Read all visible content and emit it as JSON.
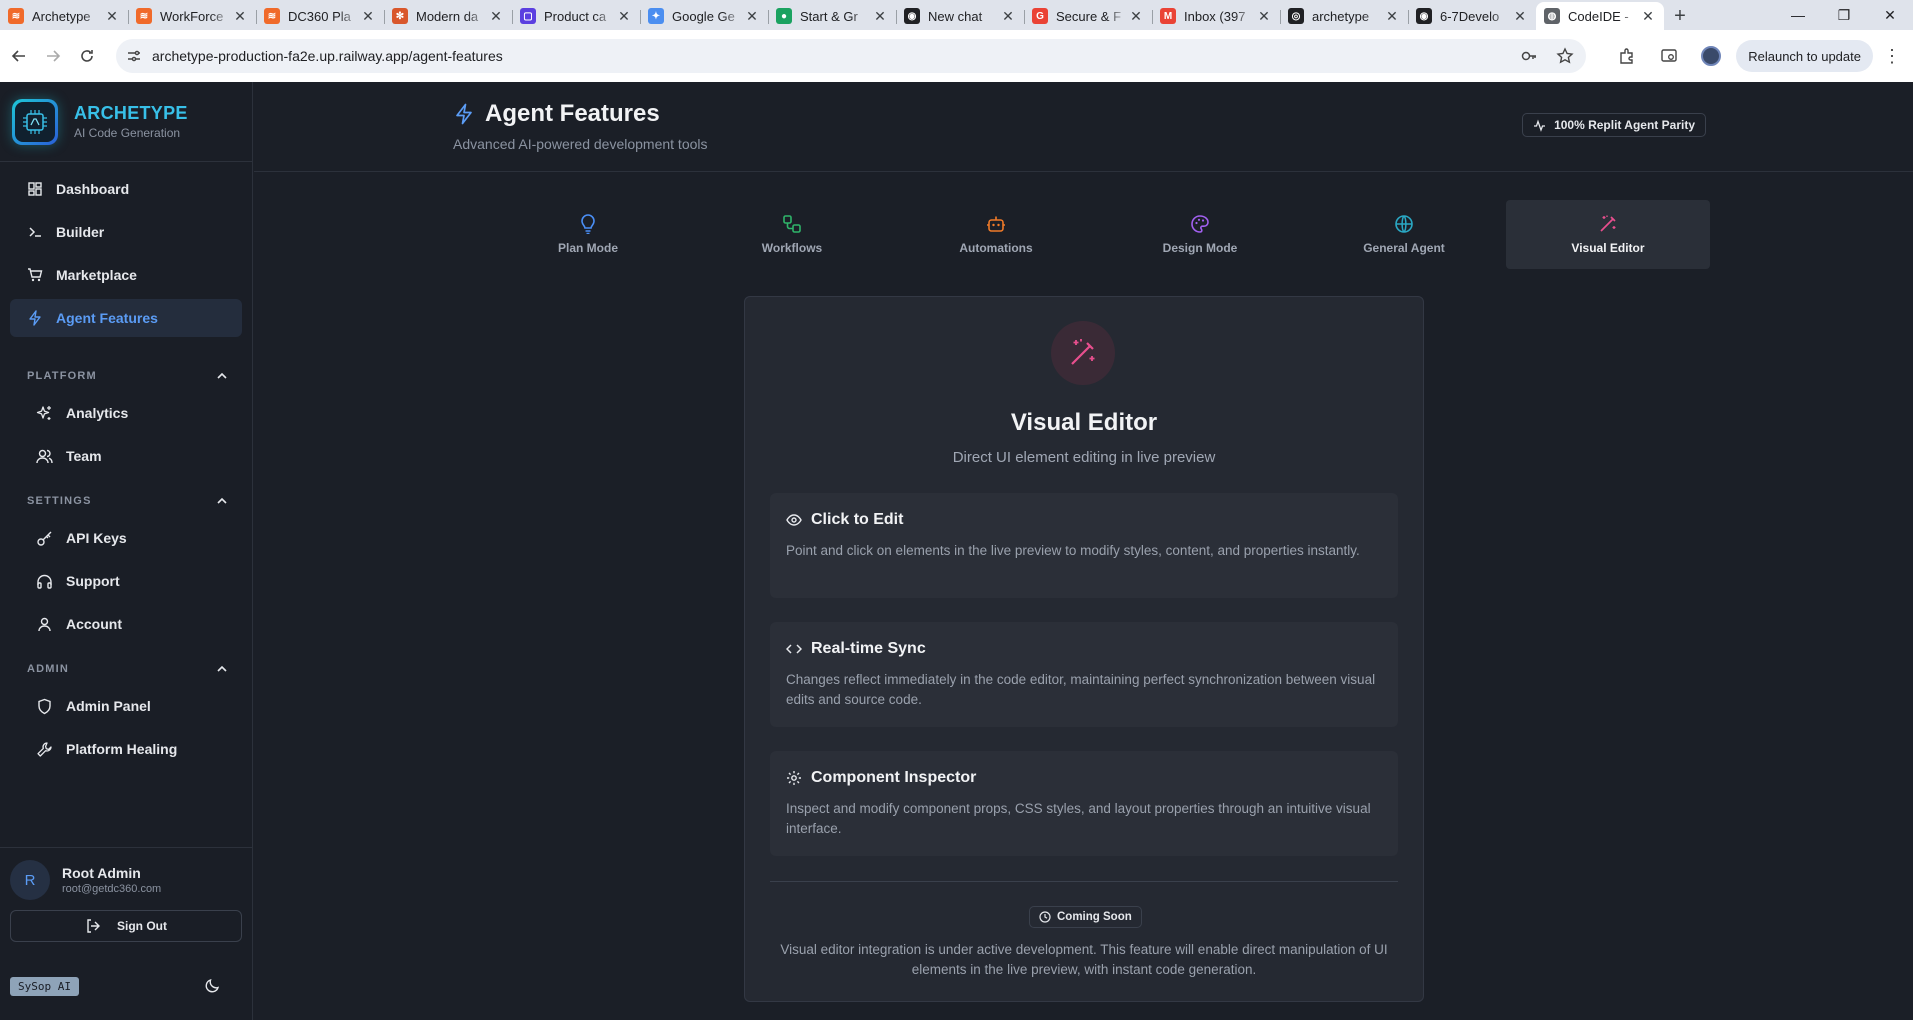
{
  "browser": {
    "tabs": [
      {
        "title": "Archetype",
        "color": "#f06a2a"
      },
      {
        "title": "WorkForce",
        "color": "#f06a2a"
      },
      {
        "title": "DC360 Pla",
        "color": "#f06a2a"
      },
      {
        "title": "Modern da",
        "color": "#d9572b"
      },
      {
        "title": "Product ca",
        "color": "#5b3fe0"
      },
      {
        "title": "Google Ge",
        "color": "#4b8ef0"
      },
      {
        "title": "Start & Gr",
        "color": "#1aa260"
      },
      {
        "title": "New chat",
        "color": "#202124"
      },
      {
        "title": "Secure & F",
        "color": "#ea4335"
      },
      {
        "title": "Inbox (397",
        "color": "#ea4335"
      },
      {
        "title": "archetype",
        "color": "#202124"
      },
      {
        "title": "6-7Develo",
        "color": "#202124"
      },
      {
        "title": "CodeIDE -",
        "color": "#5f6368"
      }
    ],
    "active_tab_index": 12,
    "url": "archetype-production-fa2e.up.railway.app/agent-features",
    "relaunch_label": "Relaunch to update"
  },
  "sidebar": {
    "brand_name": "ARCHETYPE",
    "brand_sub": "AI Code Generation",
    "nav": [
      {
        "label": "Dashboard",
        "icon": "grid-icon"
      },
      {
        "label": "Builder",
        "icon": "terminal-icon"
      },
      {
        "label": "Marketplace",
        "icon": "cart-icon"
      },
      {
        "label": "Agent Features",
        "icon": "lightning-icon",
        "active": true
      }
    ],
    "sections": {
      "platform": {
        "title": "PLATFORM",
        "items": [
          {
            "label": "Analytics"
          },
          {
            "label": "Team"
          }
        ]
      },
      "settings": {
        "title": "SETTINGS",
        "items": [
          {
            "label": "API Keys"
          },
          {
            "label": "Support"
          },
          {
            "label": "Account"
          }
        ]
      },
      "admin": {
        "title": "ADMIN",
        "items": [
          {
            "label": "Admin Panel"
          },
          {
            "label": "Platform Healing"
          }
        ]
      }
    },
    "user": {
      "initial": "R",
      "name": "Root Admin",
      "email": "root@getdc360.com"
    },
    "signout_label": "Sign Out",
    "sysop_label": "SySop AI"
  },
  "header": {
    "title": "Agent Features",
    "subtitle": "Advanced AI-powered development tools",
    "badge": "100% Replit Agent Parity"
  },
  "feature_tabs": [
    {
      "label": "Plan Mode",
      "color": "#4a8ef5",
      "icon": "lightbulb-icon"
    },
    {
      "label": "Workflows",
      "color": "#2fb56a",
      "icon": "workflow-icon"
    },
    {
      "label": "Automations",
      "color": "#f07a28",
      "icon": "robot-icon"
    },
    {
      "label": "Design Mode",
      "color": "#a260f0",
      "icon": "palette-icon"
    },
    {
      "label": "General Agent",
      "color": "#2aa8c4",
      "icon": "globe-icon"
    },
    {
      "label": "Visual Editor",
      "color": "#e84f8e",
      "icon": "magic-wand-icon",
      "active": true
    }
  ],
  "card": {
    "title": "Visual Editor",
    "subtitle": "Direct UI element editing in live preview",
    "features": [
      {
        "title": "Click to Edit",
        "desc": "Point and click on elements in the live preview to modify styles, content, and properties instantly."
      },
      {
        "title": "Real-time Sync",
        "desc": "Changes reflect immediately in the code editor, maintaining perfect synchronization between visual edits and source code."
      },
      {
        "title": "Component Inspector",
        "desc": "Inspect and modify component props, CSS styles, and layout properties through an intuitive visual interface."
      }
    ],
    "coming_label": "Coming Soon",
    "coming_desc": "Visual editor integration is under active development. This feature will enable direct manipulation of UI elements in the live preview, with instant code generation."
  }
}
